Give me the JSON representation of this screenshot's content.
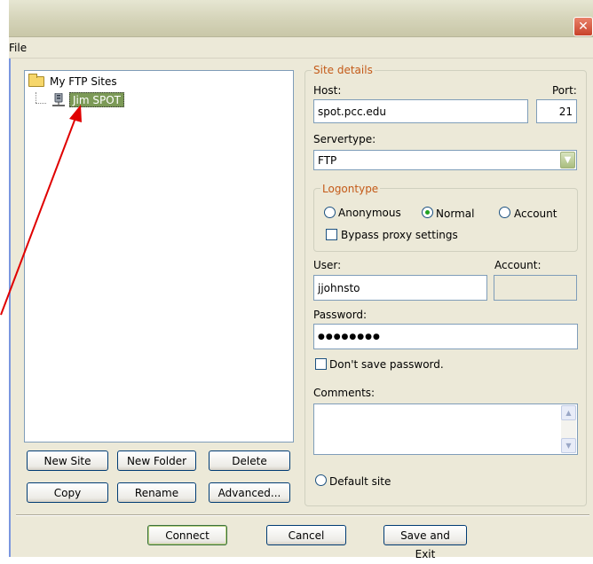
{
  "window": {
    "close_glyph": "✕"
  },
  "menu": {
    "file": "File"
  },
  "tree": {
    "root_label": "My FTP Sites",
    "selected_site": "Jim SPOT"
  },
  "site_details": {
    "legend": "Site details",
    "host_label": "Host:",
    "host_value": "spot.pcc.edu",
    "port_label": "Port:",
    "port_value": "21",
    "servertype_label": "Servertype:",
    "servertype_value": "FTP"
  },
  "logontype": {
    "legend": "Logontype",
    "anonymous": "Anonymous",
    "normal": "Normal",
    "account": "Account",
    "selected": "normal",
    "bypass_proxy": "Bypass proxy settings"
  },
  "credentials": {
    "user_label": "User:",
    "user_value": "jjohnsto",
    "account_label": "Account:",
    "account_value": "",
    "password_label": "Password:",
    "password_value": "●●●●●●●●",
    "dont_save_password": "Don't save password.",
    "comments_label": "Comments:",
    "comments_value": ""
  },
  "default_site": "Default site",
  "buttons": {
    "new_site": "New Site",
    "new_folder": "New Folder",
    "delete": "Delete",
    "copy": "Copy",
    "rename": "Rename",
    "advanced": "Advanced...",
    "connect": "Connect",
    "cancel": "Cancel",
    "save_exit": "Save and Exit"
  },
  "colors": {
    "accent_legend": "#c45a18",
    "selection": "#7c9a57",
    "annotation_arrow": "#e00000"
  }
}
